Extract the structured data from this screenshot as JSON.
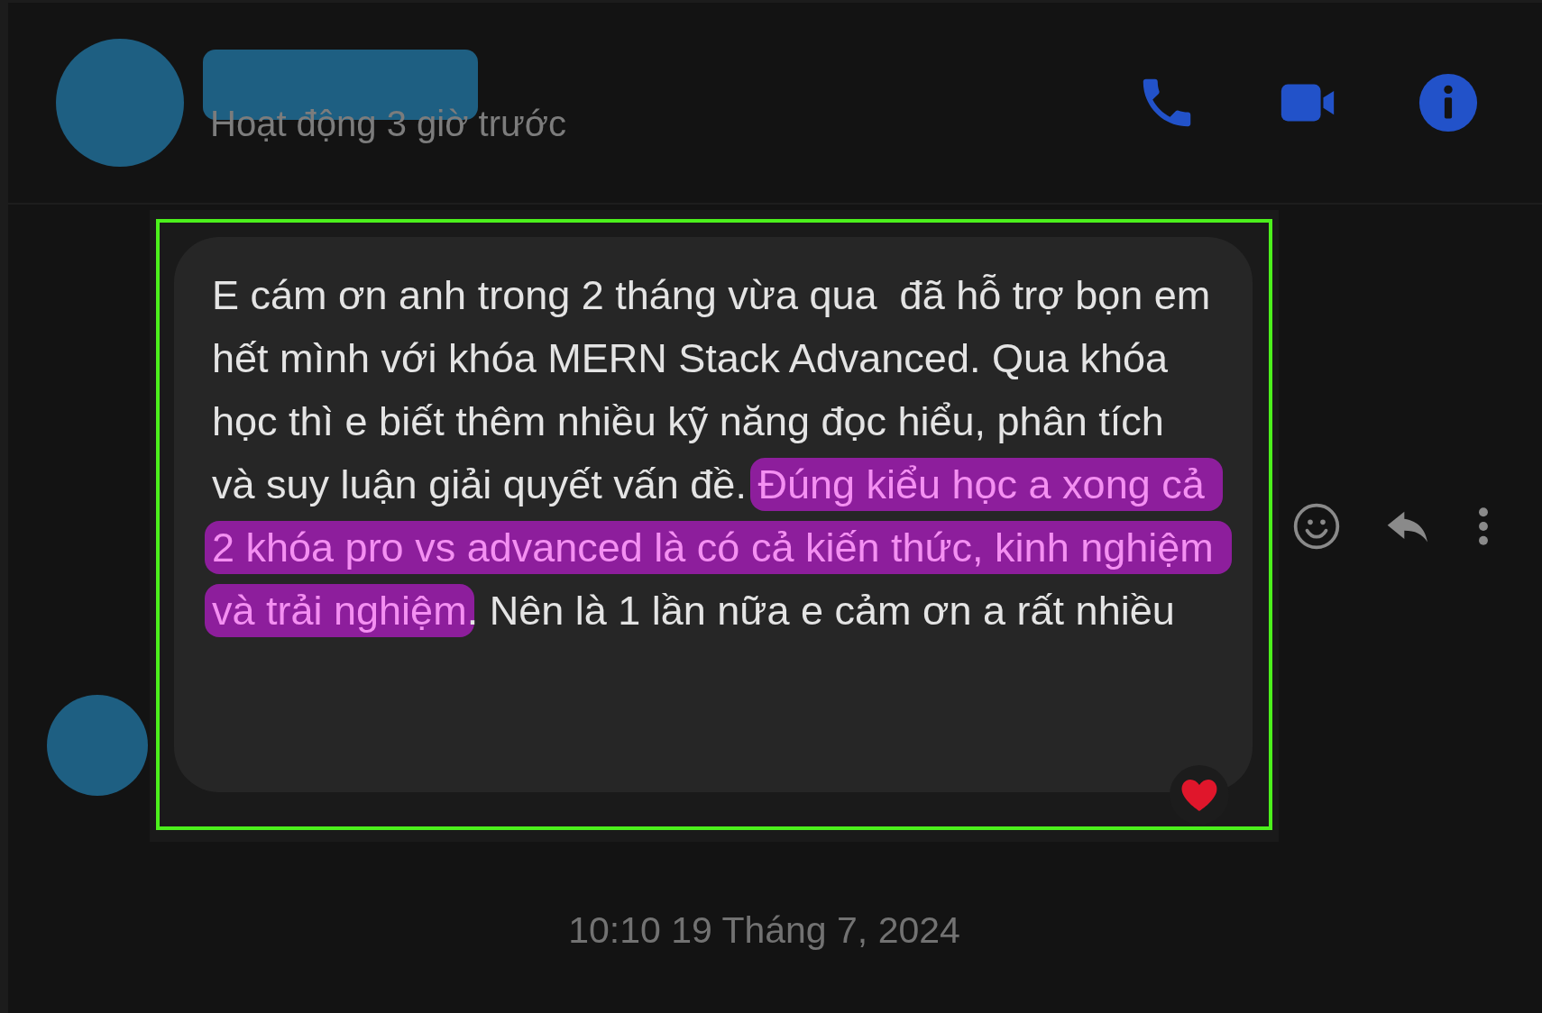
{
  "header": {
    "status": "Hoạt động 3 giờ trước"
  },
  "message": {
    "segments": [
      {
        "text": "E cám ơn anh trong 2 tháng vừa qua  đã hỗ trợ bọn em hết mình với khóa MERN Stack Advanced. Qua khóa học thì e biết thêm nhiều kỹ năng đọc hiểu, phân tích và suy luận giải quyết vấn đề. ",
        "highlighted": false
      },
      {
        "text": "Đúng kiểu học a xong cả 2 khóa pro vs advanced là có cả kiến thức, kinh nghiệm và trải nghiệm",
        "highlighted": true
      },
      {
        "text": ". Nên là 1 lần nữa e cảm ơn a rất nhiều",
        "highlighted": false
      }
    ]
  },
  "timestamp": "10:10 19 Tháng 7, 2024"
}
